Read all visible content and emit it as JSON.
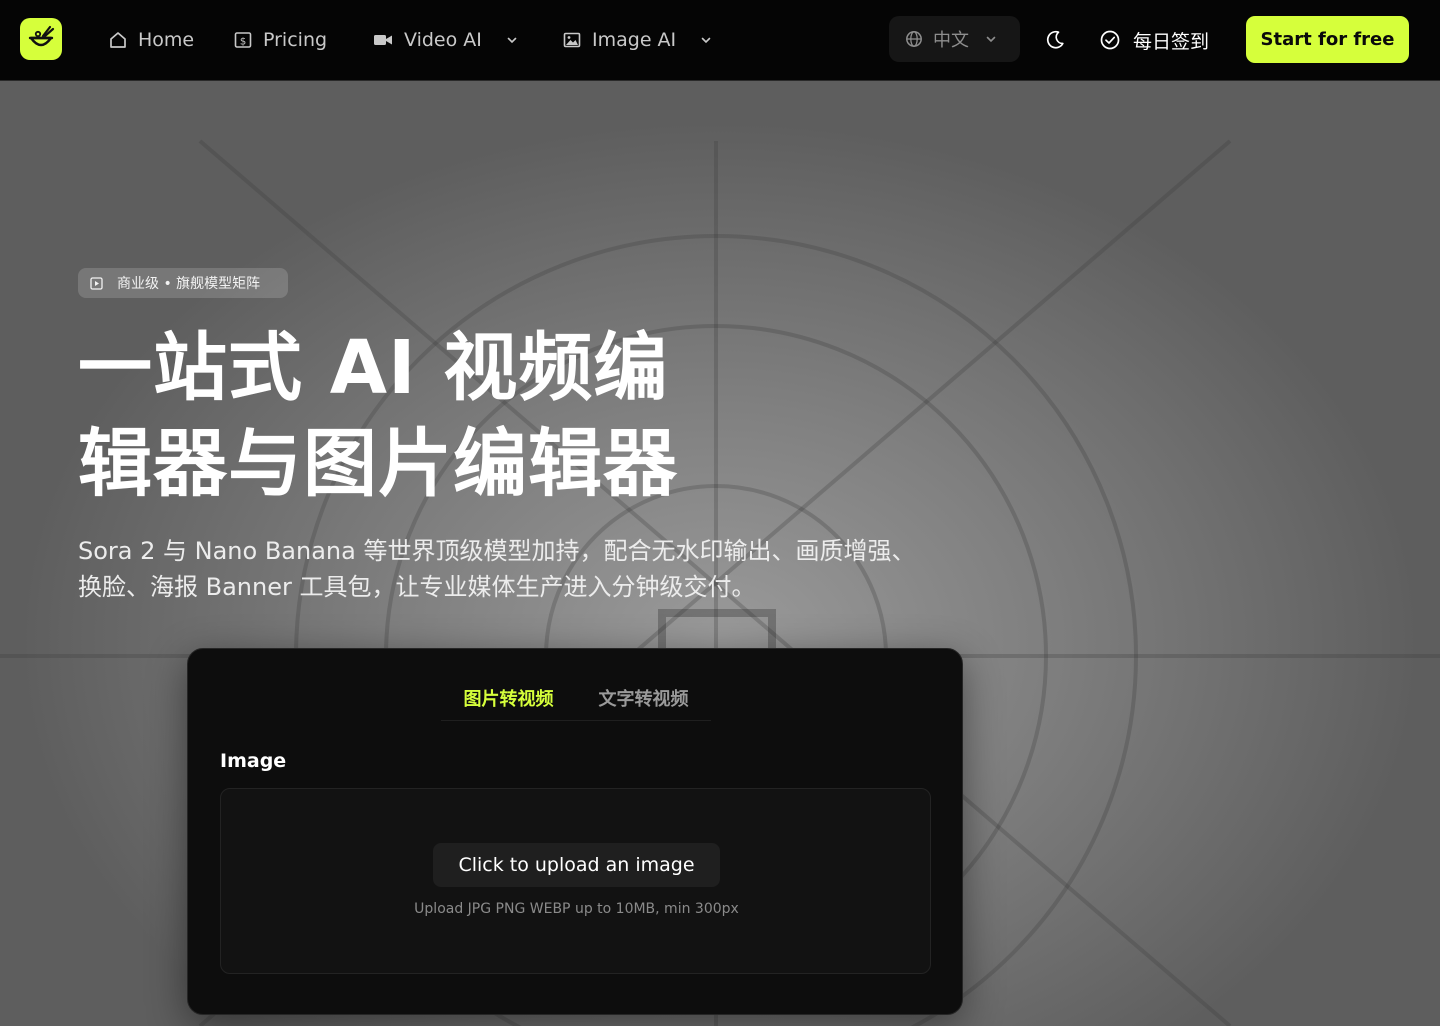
{
  "colors": {
    "accent": "#d6ff3b",
    "navbar_bg": "#050505",
    "card_bg": "#0d0d0d"
  },
  "nav": {
    "logo_icon": "bowl-chopsticks-icon",
    "items": [
      {
        "label": "Home",
        "icon": "home-icon"
      },
      {
        "label": "Pricing",
        "icon": "price-tag-icon"
      },
      {
        "label": "Video AI",
        "icon": "video-camera-icon",
        "dropdown": true
      },
      {
        "label": "Image AI",
        "icon": "image-icon",
        "dropdown": true
      }
    ],
    "language": "中文",
    "theme_icon": "moon-icon",
    "checkin_label": "每日签到",
    "cta_label": "Start for free"
  },
  "hero": {
    "badge": "商业级 • 旗舰模型矩阵",
    "title_line1": "一站式 AI 视频编",
    "title_line2": "辑器与图片编辑器",
    "subtitle": "Sora 2 与 Nano Banana 等世界顶级模型加持，配合无水印输出、画质增强、换脸、海报 Banner 工具包，让专业媒体生产进入分钟级交付。"
  },
  "generator": {
    "tabs": [
      "图片转视频",
      "文字转视频"
    ],
    "active_tab": 0,
    "field_label": "Image",
    "upload_button": "Click to upload an image",
    "upload_hint": "Upload JPG PNG WEBP up to 10MB, min 300px"
  }
}
